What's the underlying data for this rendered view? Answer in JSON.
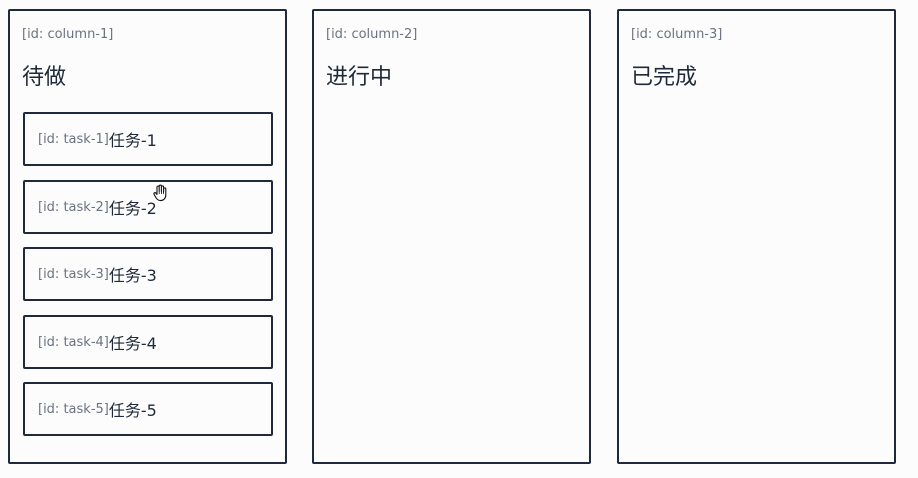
{
  "columns": [
    {
      "id_label": "[id: column-1]",
      "title": "待做",
      "tasks": [
        {
          "id_label": "[id: task-1]",
          "label": "任务-1"
        },
        {
          "id_label": "[id: task-2]",
          "label": "任务-2"
        },
        {
          "id_label": "[id: task-3]",
          "label": "任务-3"
        },
        {
          "id_label": "[id: task-4]",
          "label": "任务-4"
        },
        {
          "id_label": "[id: task-5]",
          "label": "任务-5"
        }
      ]
    },
    {
      "id_label": "[id: column-2]",
      "title": "进行中",
      "tasks": []
    },
    {
      "id_label": "[id: column-3]",
      "title": "已完成",
      "tasks": []
    }
  ],
  "cursor": {
    "icon": "grab-hand-icon"
  }
}
